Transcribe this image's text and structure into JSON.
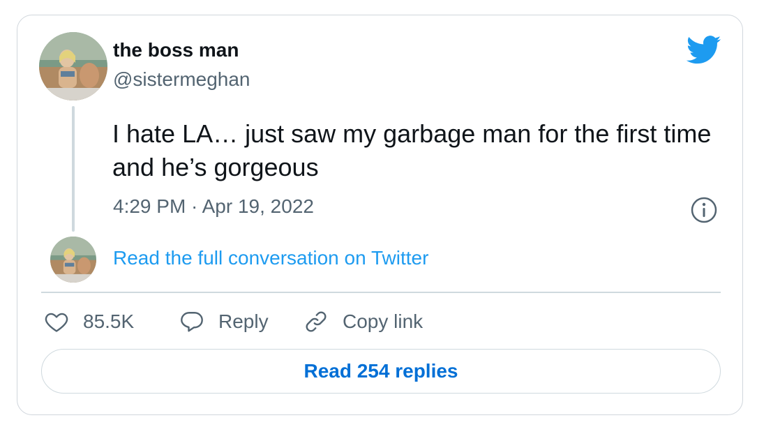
{
  "author": {
    "display_name": "the boss man",
    "handle": "@sistermeghan"
  },
  "tweet": {
    "text": "I hate LA… just saw my garbage man for the first time and he’s gorgeous",
    "timestamp": "4:29 PM · Apr 19, 2022"
  },
  "conversation": {
    "link_label": "Read the full conversation on Twitter"
  },
  "actions": {
    "like_count": "85.5K",
    "reply_label": "Reply",
    "copy_link_label": "Copy link"
  },
  "footer": {
    "read_replies_label": "Read 254 replies"
  },
  "icons": {
    "brand": "twitter-bird-icon",
    "info": "info-icon",
    "like": "heart-icon",
    "reply": "speech-bubble-icon",
    "copy": "link-icon"
  },
  "colors": {
    "brand_blue": "#1d9bf0",
    "link_blue": "#006fd6",
    "text_primary": "#0f1419",
    "text_secondary": "#536471",
    "border": "#cfd9de"
  }
}
